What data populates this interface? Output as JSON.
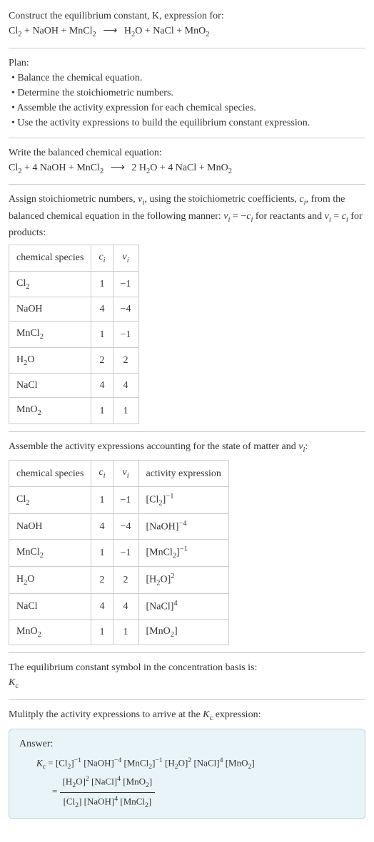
{
  "intro": {
    "line1": "Construct the equilibrium constant, K, expression for:",
    "equation": "Cl₂ + NaOH + MnCl₂  ⟶  H₂O + NaCl + MnO₂"
  },
  "plan": {
    "heading": "Plan:",
    "items": [
      "• Balance the chemical equation.",
      "• Determine the stoichiometric numbers.",
      "• Assemble the activity expression for each chemical species.",
      "• Use the activity expressions to build the equilibrium constant expression."
    ]
  },
  "balanced": {
    "heading": "Write the balanced chemical equation:",
    "equation": "Cl₂ + 4 NaOH + MnCl₂  ⟶  2 H₂O + 4 NaCl + MnO₂"
  },
  "stoich": {
    "text": "Assign stoichiometric numbers, νᵢ, using the stoichiometric coefficients, cᵢ, from the balanced chemical equation in the following manner: νᵢ = −cᵢ for reactants and νᵢ = cᵢ for products:",
    "headers": [
      "chemical species",
      "cᵢ",
      "νᵢ"
    ],
    "rows": [
      {
        "species": "Cl₂",
        "c": "1",
        "v": "−1"
      },
      {
        "species": "NaOH",
        "c": "4",
        "v": "−4"
      },
      {
        "species": "MnCl₂",
        "c": "1",
        "v": "−1"
      },
      {
        "species": "H₂O",
        "c": "2",
        "v": "2"
      },
      {
        "species": "NaCl",
        "c": "4",
        "v": "4"
      },
      {
        "species": "MnO₂",
        "c": "1",
        "v": "1"
      }
    ]
  },
  "activity": {
    "text": "Assemble the activity expressions accounting for the state of matter and νᵢ:",
    "headers": [
      "chemical species",
      "cᵢ",
      "νᵢ",
      "activity expression"
    ],
    "rows": [
      {
        "species": "Cl₂",
        "c": "1",
        "v": "−1",
        "expr": "[Cl₂]⁻¹"
      },
      {
        "species": "NaOH",
        "c": "4",
        "v": "−4",
        "expr": "[NaOH]⁻⁴"
      },
      {
        "species": "MnCl₂",
        "c": "1",
        "v": "−1",
        "expr": "[MnCl₂]⁻¹"
      },
      {
        "species": "H₂O",
        "c": "2",
        "v": "2",
        "expr": "[H₂O]²"
      },
      {
        "species": "NaCl",
        "c": "4",
        "v": "4",
        "expr": "[NaCl]⁴"
      },
      {
        "species": "MnO₂",
        "c": "1",
        "v": "1",
        "expr": "[MnO₂]"
      }
    ]
  },
  "symbol": {
    "line1": "The equilibrium constant symbol in the concentration basis is:",
    "line2": "K_c"
  },
  "multiply": {
    "text": "Mulitply the activity expressions to arrive at the K_c expression:"
  },
  "answer": {
    "label": "Answer:",
    "line1_lhs": "K_c = ",
    "line1_rhs": "[Cl₂]⁻¹ [NaOH]⁻⁴ [MnCl₂]⁻¹ [H₂O]² [NaCl]⁴ [MnO₂]",
    "frac_num": "[H₂O]² [NaCl]⁴ [MnO₂]",
    "frac_den": "[Cl₂] [NaOH]⁴ [MnCl₂]",
    "eq_sign": "= "
  },
  "chart_data": {
    "type": "table",
    "tables": [
      {
        "title": "Stoichiometric numbers",
        "columns": [
          "chemical species",
          "cᵢ",
          "νᵢ"
        ],
        "rows": [
          [
            "Cl₂",
            1,
            -1
          ],
          [
            "NaOH",
            4,
            -4
          ],
          [
            "MnCl₂",
            1,
            -1
          ],
          [
            "H₂O",
            2,
            2
          ],
          [
            "NaCl",
            4,
            4
          ],
          [
            "MnO₂",
            1,
            1
          ]
        ]
      },
      {
        "title": "Activity expressions",
        "columns": [
          "chemical species",
          "cᵢ",
          "νᵢ",
          "activity expression"
        ],
        "rows": [
          [
            "Cl₂",
            1,
            -1,
            "[Cl₂]⁻¹"
          ],
          [
            "NaOH",
            4,
            -4,
            "[NaOH]⁻⁴"
          ],
          [
            "MnCl₂",
            1,
            -1,
            "[MnCl₂]⁻¹"
          ],
          [
            "H₂O",
            2,
            2,
            "[H₂O]²"
          ],
          [
            "NaCl",
            4,
            4,
            "[NaCl]⁴"
          ],
          [
            "MnO₂",
            1,
            1,
            "[MnO₂]"
          ]
        ]
      }
    ]
  }
}
